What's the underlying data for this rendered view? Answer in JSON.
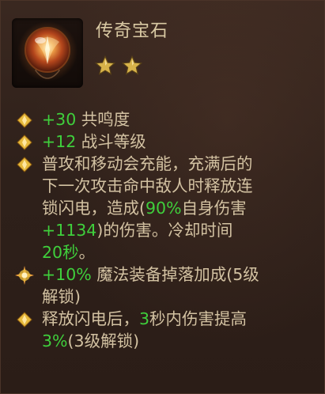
{
  "item": {
    "name": "传奇宝石",
    "star_count": 2,
    "icon": "legendary-gem-icon"
  },
  "colors": {
    "title": "#d9c9a3",
    "text": "#d3c2a2",
    "highlight": "#3fcf3c",
    "star": "#d8b34a"
  },
  "stats": {
    "resonance_value": "+30",
    "resonance_label": " 共鸣度",
    "rating_value": "+12",
    "rating_label": " 战斗等级"
  },
  "effect": {
    "line1": "普攻和移动会充能，充满后的",
    "line2": "下一次攻击命中敌人时释放连",
    "line3_a": "锁闪电，造成(",
    "line3_value": "90%",
    "line3_b": "自身伤害",
    "line4_value": "+1134",
    "line4_b": ")的伤害。冷却时间",
    "line5_value": "20秒",
    "line5_b": "。"
  },
  "rank5": {
    "value": "+10%",
    "label": " 魔法装备掉落加成(5级",
    "line2": "解锁)"
  },
  "rank3": {
    "a": "释放闪电后，",
    "value1": "3",
    "b": "秒内伤害提高",
    "value2": "3%",
    "c": "(3级解锁)"
  }
}
